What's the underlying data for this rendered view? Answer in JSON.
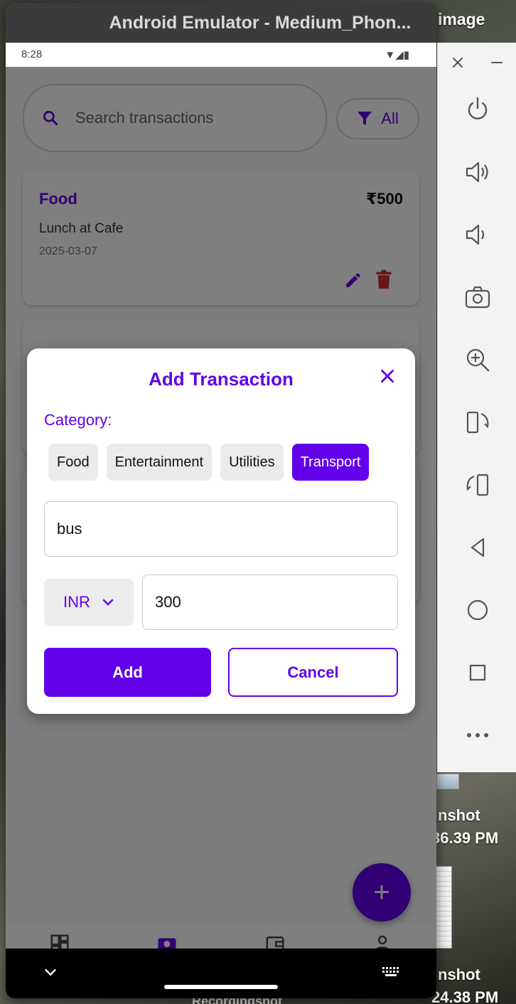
{
  "desktop": {
    "window_label": "image",
    "labels": [
      "nshot",
      "36.39 PM",
      "nshot",
      "24.38 PM"
    ],
    "bottom_text": "Recordingshot"
  },
  "emulator": {
    "title": "Android Emulator - Medium_Phon...",
    "status_time": "8:28",
    "toolbar": {
      "icons": [
        "close-icon",
        "minimize-icon",
        "power-icon",
        "volume-up-icon",
        "volume-down-icon",
        "camera-icon",
        "zoom-icon",
        "rotate-left-icon",
        "rotate-right-icon",
        "back-icon",
        "home-icon",
        "overview-icon",
        "more-icon"
      ]
    }
  },
  "app": {
    "search": {
      "placeholder": "Search transactions"
    },
    "filter": {
      "label": "All"
    },
    "transactions": [
      {
        "category": "Food",
        "amount": "₹500",
        "description": "Lunch at Cafe",
        "date": "2025-03-07"
      }
    ],
    "fab_label": "+",
    "bottom_nav": [
      "dashboard-icon",
      "transactions-icon",
      "wallet-icon",
      "profile-icon"
    ]
  },
  "dialog": {
    "title": "Add Transaction",
    "category_label": "Category:",
    "categories": [
      "Food",
      "Entertainment",
      "Utilities",
      "Transport"
    ],
    "selected_category": "Transport",
    "description_value": "bus",
    "currency": "INR",
    "amount_value": "300",
    "add_label": "Add",
    "cancel_label": "Cancel"
  },
  "colors": {
    "accent": "#6200ea",
    "delete": "#d32f2f",
    "chip_bg": "#ebebeb"
  }
}
